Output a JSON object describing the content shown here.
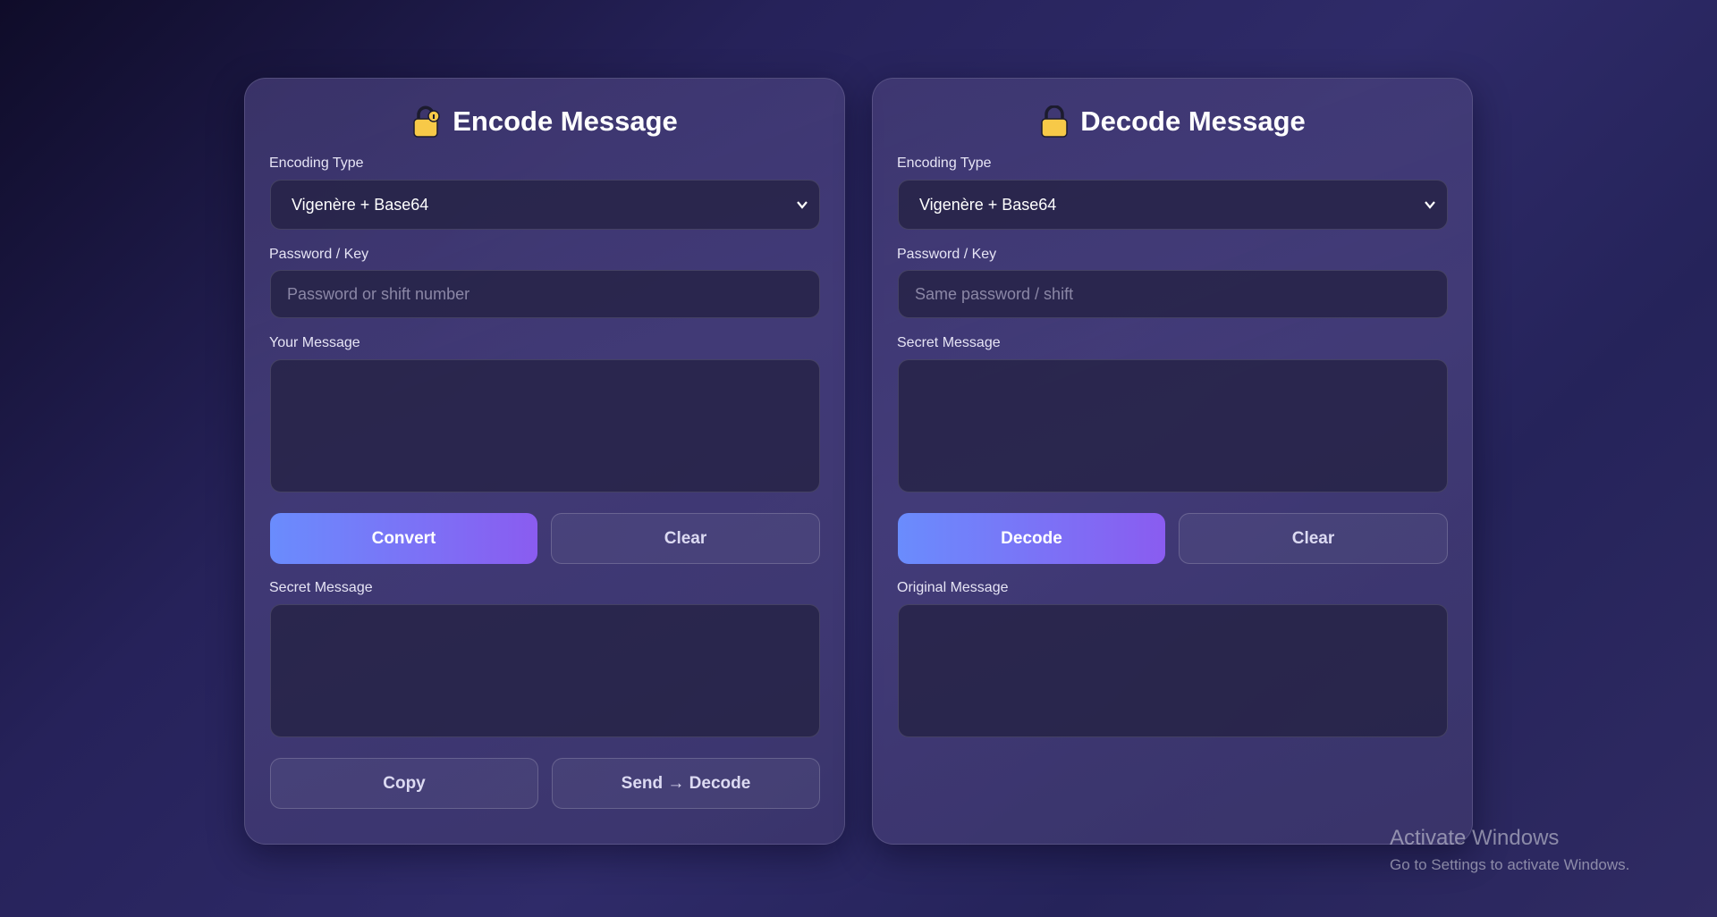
{
  "encode": {
    "title": "Encode Message",
    "encoding_type_label": "Encoding Type",
    "encoding_type_value": "Vigenère + Base64",
    "password_label": "Password / Key",
    "password_placeholder": "Password or shift number",
    "message_label": "Your Message",
    "convert_label": "Convert",
    "clear_label": "Clear",
    "secret_label": "Secret Message",
    "copy_label": "Copy",
    "send_label": "Send → Decode"
  },
  "decode": {
    "title": "Decode Message",
    "encoding_type_label": "Encoding Type",
    "encoding_type_value": "Vigenère + Base64",
    "password_label": "Password / Key",
    "password_placeholder": "Same password / shift",
    "secret_label": "Secret Message",
    "decode_label": "Decode",
    "clear_label": "Clear",
    "original_label": "Original Message"
  },
  "watermark": {
    "title": "Activate Windows",
    "subtitle": "Go to Settings to activate Windows."
  },
  "icons": {
    "encode": "unlocked-padlock-icon",
    "decode": "locked-padlock-icon"
  },
  "colors": {
    "accent_start": "#6a8cfd",
    "accent_end": "#8a5cf0",
    "lock": "#f7c948"
  }
}
